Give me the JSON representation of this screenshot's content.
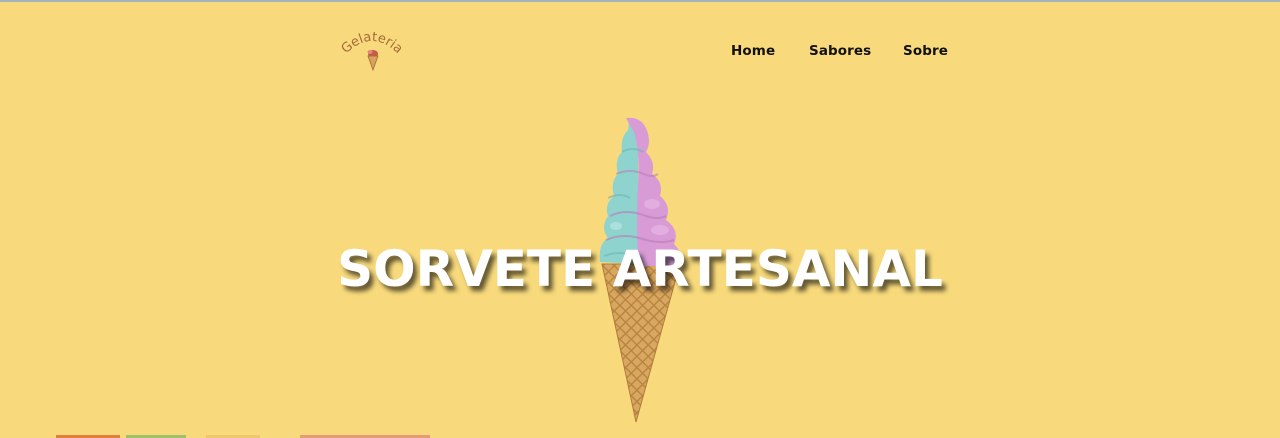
{
  "brand": {
    "logo_text": "Gelateria"
  },
  "nav": {
    "items": [
      {
        "label": "Home"
      },
      {
        "label": "Sabores"
      },
      {
        "label": "Sobre"
      }
    ]
  },
  "hero": {
    "title": "SORVETE ARTESANAL",
    "image_icon": "ice-cream-cone-icon"
  },
  "colors": {
    "background": "#f8da7c",
    "logo_brown": "#a7693a",
    "nav_text": "#111111",
    "title_text": "#ffffff",
    "swirl_blue": "#8fd3cf",
    "swirl_pink": "#d89bd6",
    "cone": "#d8a75c"
  }
}
